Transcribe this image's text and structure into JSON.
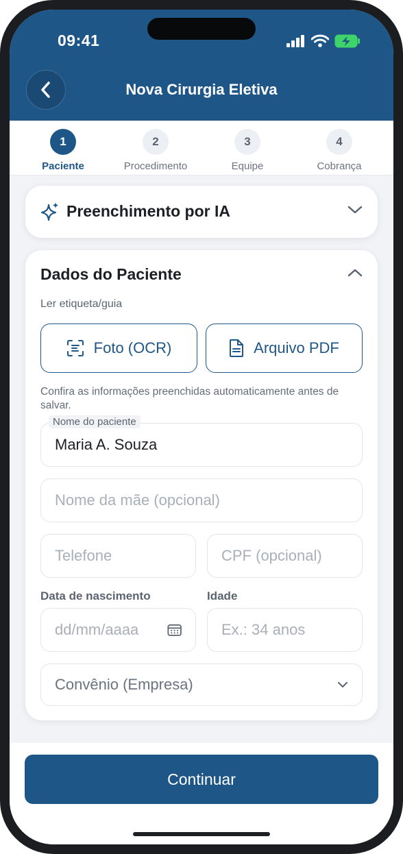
{
  "status_bar": {
    "time": "09:41"
  },
  "header": {
    "title": "Nova Cirurgia Eletiva"
  },
  "stepper": [
    {
      "number": "1",
      "label": "Paciente",
      "active": true
    },
    {
      "number": "2",
      "label": "Procedimento",
      "active": false
    },
    {
      "number": "3",
      "label": "Equipe",
      "active": false
    },
    {
      "number": "4",
      "label": "Cobrança",
      "active": false
    }
  ],
  "ai_card": {
    "title": "Preenchimento por IA"
  },
  "patient": {
    "section_title": "Dados do Paciente",
    "scan_label": "Ler etiqueta/guia",
    "ocr_button": "Foto (OCR)",
    "pdf_button": "Arquivo PDF",
    "hint": "Confira as informações preenchidas automaticamente antes de salvar.",
    "name_label": "Nome do paciente",
    "name_value": "Maria A. Souza",
    "mother_placeholder": "Nome da mãe (opcional)",
    "phone_placeholder": "Telefone",
    "cpf_placeholder": "CPF (opcional)",
    "birth_label": "Data de nascimento",
    "birth_placeholder": "dd/mm/aaaa",
    "age_label": "Idade",
    "age_placeholder": "Ex.: 34 anos",
    "plan_value": "Convênio (Empresa)"
  },
  "footer": {
    "continue_label": "Continuar"
  },
  "colors": {
    "primary": "#1e5787",
    "background": "#f1f3f6"
  }
}
